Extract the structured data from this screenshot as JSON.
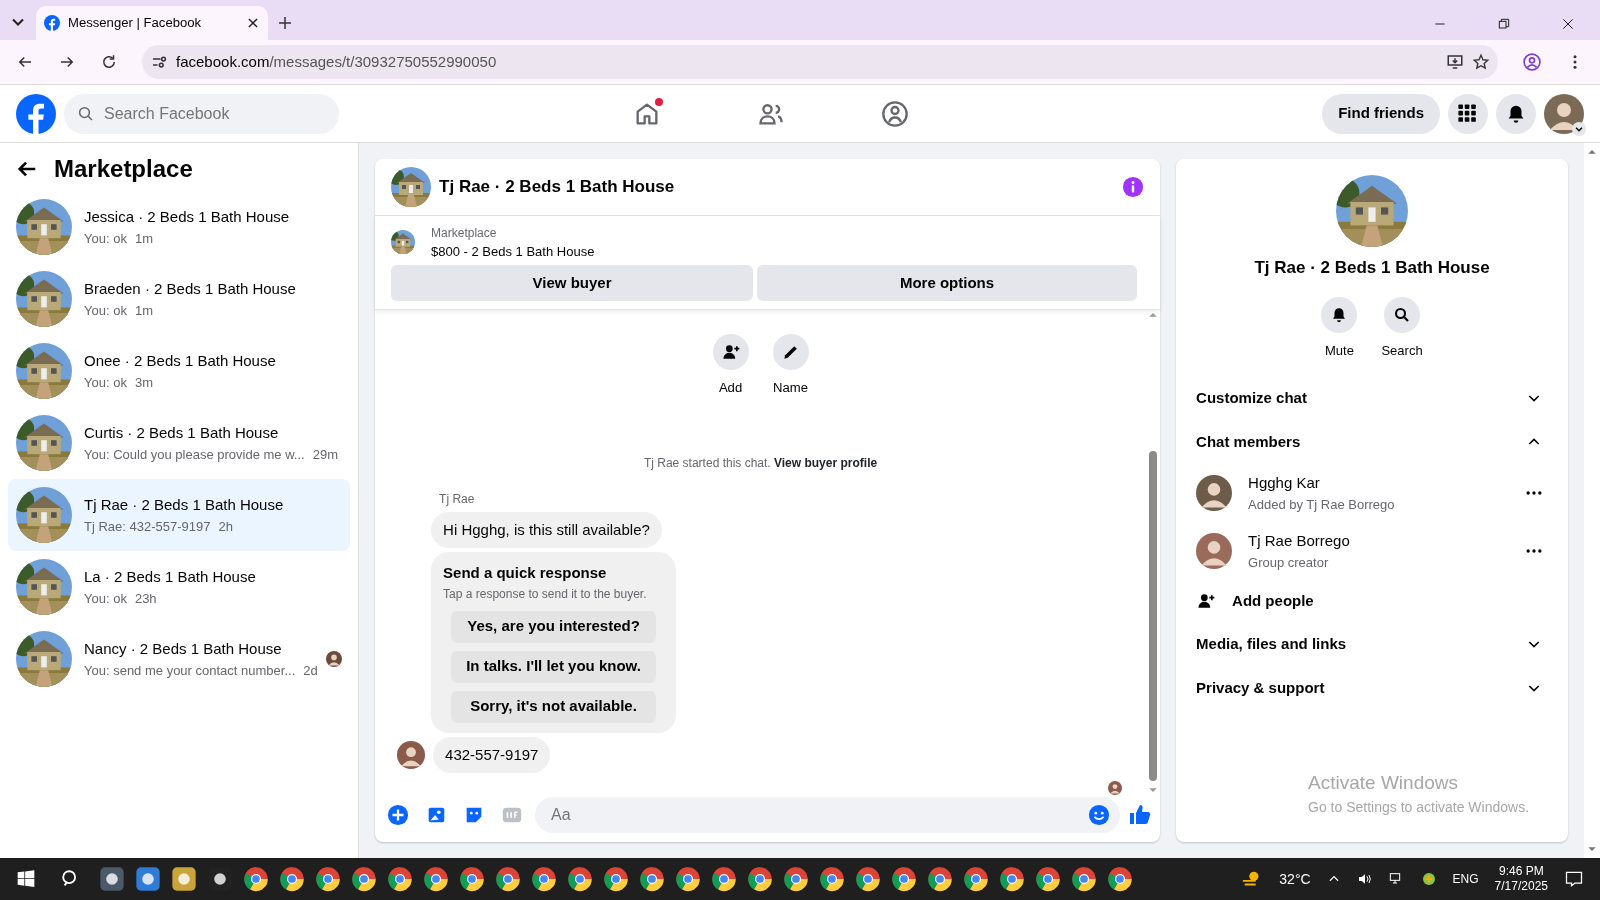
{
  "browser": {
    "tab_title": "Messenger | Facebook",
    "url_host": "facebook.com",
    "url_path": "/messages/t/30932750552990050"
  },
  "header": {
    "search_placeholder": "Search Facebook",
    "nav": [
      {
        "kind": "home",
        "notification": true
      },
      {
        "kind": "friends",
        "notification": false
      },
      {
        "kind": "groups",
        "notification": false
      }
    ],
    "find_friends": "Find friends"
  },
  "sidebar": {
    "title": "Marketplace",
    "conversations": [
      {
        "name": "Jessica · 2 Beds 1 Bath House",
        "preview": "You: ok",
        "time": "1m",
        "selected": false,
        "seen": false
      },
      {
        "name": "Braeden · 2 Beds 1 Bath House",
        "preview": "You: ok",
        "time": "1m",
        "selected": false,
        "seen": false
      },
      {
        "name": "Onee · 2 Beds 1 Bath House",
        "preview": "You: ok",
        "time": "3m",
        "selected": false,
        "seen": false
      },
      {
        "name": "Curtis · 2 Beds 1 Bath House",
        "preview": "You: Could you please provide me w...",
        "time": "29m",
        "selected": false,
        "seen": false
      },
      {
        "name": "Tj Rae · 2 Beds 1 Bath House",
        "preview": "Tj Rae: 432-557-9197",
        "time": "2h",
        "selected": true,
        "seen": false
      },
      {
        "name": "La · 2 Beds 1 Bath House",
        "preview": "You: ok",
        "time": "23h",
        "selected": false,
        "seen": false
      },
      {
        "name": "Nancy · 2 Beds 1 Bath House",
        "preview": "You: send me your contact number...",
        "time": "2d",
        "selected": false,
        "seen": true
      }
    ]
  },
  "chat": {
    "title": "Tj Rae · 2 Beds 1 Bath House",
    "listing": {
      "label": "Marketplace",
      "title": "$800 - 2 Beds 1 Bath House"
    },
    "buttons": [
      "View buyer",
      "More options"
    ],
    "actions": [
      {
        "kind": "add",
        "label": "Add"
      },
      {
        "kind": "name",
        "label": "Name"
      }
    ],
    "note": {
      "text": "Tj Rae started this chat.",
      "link": "View buyer profile"
    },
    "sender": "Tj Rae",
    "first_message": "Hi Hgghg, is this still available?",
    "quick_response": {
      "title": "Send a quick response",
      "subtitle": "Tap a response to send it to the buyer.",
      "options": [
        "Yes, are you interested?",
        "In talks. I'll let you know.",
        "Sorry, it's not available."
      ]
    },
    "last_message": "432-557-9197",
    "composer_placeholder": "Aa"
  },
  "details": {
    "title": "Tj Rae · 2 Beds 1 Bath House",
    "actions": [
      {
        "kind": "mute",
        "label": "Mute"
      },
      {
        "kind": "search",
        "label": "Search"
      }
    ],
    "sections": [
      {
        "label": "Customize chat",
        "expanded": false
      },
      {
        "label": "Chat members",
        "expanded": true,
        "members": [
          {
            "name": "Hgghg Kar",
            "subtitle": "Added by Tj Rae Borrego"
          },
          {
            "name": "Tj Rae Borrego",
            "subtitle": "Group creator"
          }
        ],
        "add_label": "Add people"
      },
      {
        "label": "Media, files and links",
        "expanded": false
      },
      {
        "label": "Privacy & support",
        "expanded": false
      }
    ]
  },
  "activation_notice": {
    "title": "Activate Windows",
    "subtitle": "Go to Settings to activate Windows."
  },
  "taskbar": {
    "temperature": "32°C",
    "language": "ENG",
    "time": "9:46 PM",
    "date": "7/17/2025"
  }
}
